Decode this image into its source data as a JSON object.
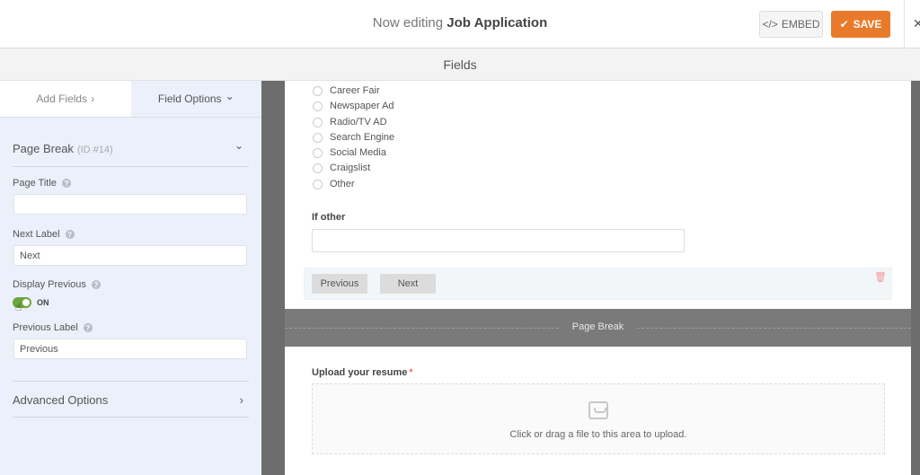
{
  "header": {
    "title_prefix": "Now editing",
    "title_form_name": "Job Application",
    "embed_icon": "</>",
    "embed_label": "EMBED",
    "save_icon": "✔",
    "save_label": "SAVE",
    "close_icon": "✕",
    "accent_color": "#e97a2b"
  },
  "subheader": {
    "title": "Fields"
  },
  "sidebar": {
    "tabs": [
      {
        "label": "Add Fields",
        "icon": "›",
        "active": false
      },
      {
        "label": "Field Options",
        "icon": "⌄",
        "active": true
      }
    ],
    "field_section": {
      "title": "Page Break",
      "id_text": "(ID #14)",
      "chevron": "⌄"
    },
    "page_title": {
      "label": "Page Title",
      "value": ""
    },
    "next_label": {
      "label": "Next Label",
      "value": "Next"
    },
    "display_previous": {
      "label": "Display Previous",
      "state": "ON",
      "enabled": true
    },
    "previous_label": {
      "label": "Previous Label",
      "value": "Previous"
    },
    "advanced": {
      "title": "Advanced Options",
      "chevron": "›"
    },
    "help_icon": "?"
  },
  "form": {
    "radio_options": [
      "Career Fair",
      "Newspaper Ad",
      "Radio/TV AD",
      "Search Engine",
      "Social Media",
      "Craigslist",
      "Other"
    ],
    "if_other": {
      "label": "If other",
      "value": ""
    },
    "nav_buttons": {
      "previous": "Previous",
      "next": "Next"
    },
    "trash_icon": "🗑",
    "page_break_label": "Page Break",
    "upload": {
      "label": "Upload your resume",
      "required_mark": "*",
      "hint": "Click or drag a file to this area to upload."
    }
  }
}
